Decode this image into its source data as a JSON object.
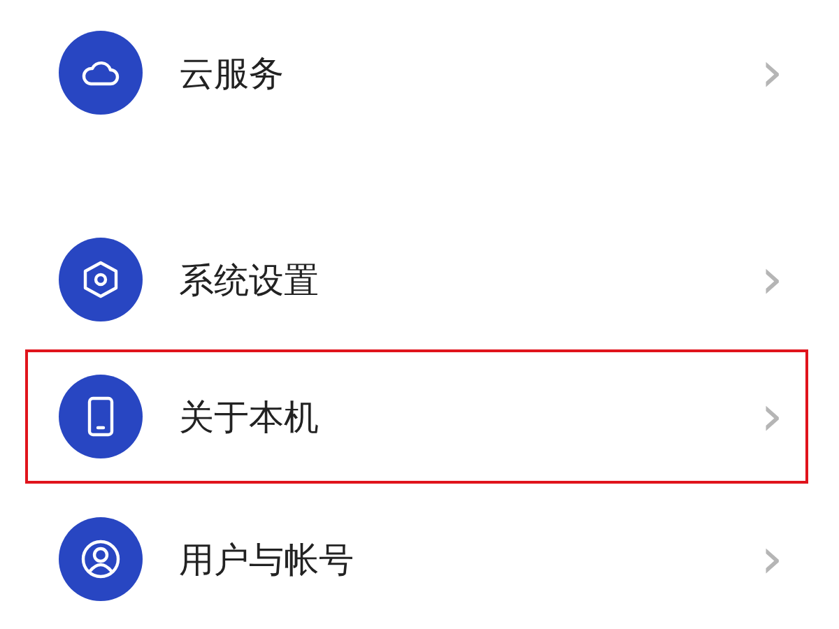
{
  "groups": [
    {
      "items": [
        {
          "label": "云服务",
          "chevron": "›",
          "highlighted": false
        }
      ]
    },
    {
      "items": [
        {
          "label": "系统设置",
          "chevron": "›",
          "highlighted": false
        },
        {
          "label": "关于本机",
          "chevron": "›",
          "highlighted": true
        },
        {
          "label": "用户与帐号",
          "chevron": "›",
          "highlighted": false
        }
      ]
    }
  ]
}
